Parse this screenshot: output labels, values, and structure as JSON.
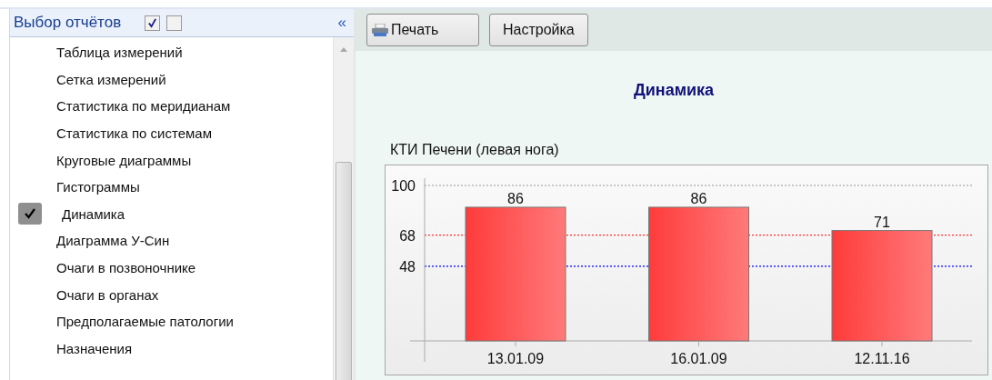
{
  "panel": {
    "title": "Выбор отчётов",
    "select_all": {
      "checked": true
    },
    "select_none": {
      "checked": false
    },
    "collapse": "«",
    "items": [
      {
        "label": "Таблица измерений",
        "checked": false
      },
      {
        "label": "Сетка измерений",
        "checked": false
      },
      {
        "label": "Статистика по меридианам",
        "checked": false
      },
      {
        "label": "Статистика по системам",
        "checked": false
      },
      {
        "label": "Круговые диаграммы",
        "checked": false
      },
      {
        "label": "Гистограммы",
        "checked": false
      },
      {
        "label": "Динамика",
        "checked": true
      },
      {
        "label": "Диаграмма У-Син",
        "checked": false
      },
      {
        "label": "Очаги в позвоночнике",
        "checked": false
      },
      {
        "label": "Очаги в органах",
        "checked": false
      },
      {
        "label": "Предполагаемые патологии",
        "checked": false
      },
      {
        "label": "Назначения",
        "checked": false
      }
    ]
  },
  "toolbar": {
    "buttons": [
      {
        "label": "Печать",
        "kind": "print"
      },
      {
        "label": "Настройка",
        "kind": "plain"
      }
    ]
  },
  "report": {
    "title": "Динамика",
    "chart_data": {
      "type": "bar",
      "title": "КТИ Печени (левая нога)",
      "categories": [
        "13.01.09",
        "16.01.09",
        "12.11.16"
      ],
      "values": [
        86,
        86,
        71
      ],
      "ylim": [
        0,
        100
      ],
      "yticks": [
        48,
        68,
        100
      ],
      "data_labels": true,
      "ref_lines": [
        {
          "axis": "y",
          "value": 100,
          "color": "#b8b8b8"
        },
        {
          "axis": "y",
          "value": 68,
          "color": "#ff3030"
        },
        {
          "axis": "y",
          "value": 48,
          "color": "#0000ff"
        }
      ]
    }
  }
}
